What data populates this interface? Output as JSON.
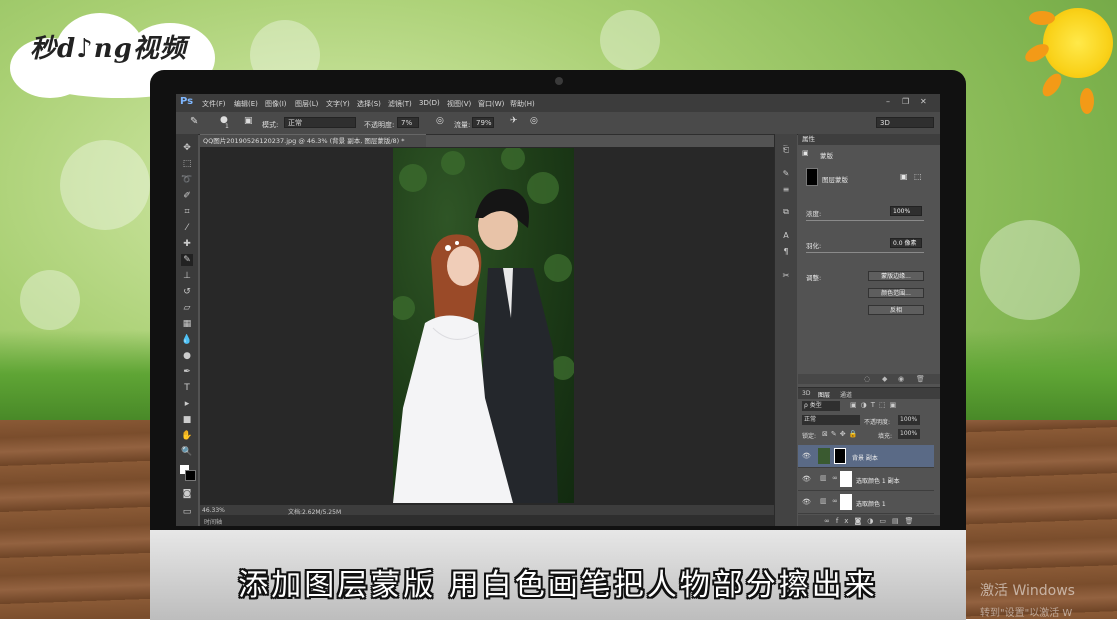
{
  "brand": {
    "logo_text": "秒d♪ng视频"
  },
  "app": {
    "ps_logo": "Ps",
    "menus": [
      "文件(F)",
      "编辑(E)",
      "图像(I)",
      "图层(L)",
      "文字(Y)",
      "选择(S)",
      "滤镜(T)",
      "3D(D)",
      "视图(V)",
      "窗口(W)",
      "帮助(H)"
    ],
    "window_controls": [
      "–",
      "❐",
      "✕"
    ]
  },
  "options": {
    "mode_label": "模式:",
    "mode_value": "正常",
    "opacity_label": "不透明度:",
    "opacity_value": "7%",
    "flow_label": "流量:",
    "flow_value": "79%",
    "workspace": "3D",
    "brush_size": "1"
  },
  "document": {
    "tab_title": "QQ图片20190526120237.jpg @ 46.3% (背景 副本, 图层蒙版/8) *",
    "tab_close": "×",
    "zoom": "46.33%",
    "doc_size": "文档:2.62M/5.25M",
    "timeline": "时间轴"
  },
  "properties": {
    "panel_title": "属性",
    "mask_type": "蒙版",
    "mask_name": "图层蒙版",
    "density_label": "浓度:",
    "density_value": "100%",
    "feather_label": "羽化:",
    "feather_value": "0.0 像素",
    "adjust_label": "调整:",
    "buttons": [
      "蒙版边缘...",
      "颜色范围...",
      "反相"
    ]
  },
  "layers": {
    "tabs": [
      "3D",
      "图层",
      "通道"
    ],
    "filter_kind": "ρ 类型",
    "blend_mode": "正常",
    "opacity_label": "不透明度:",
    "opacity_value": "100%",
    "lock_label": "锁定:",
    "fill_label": "填充:",
    "fill_value": "100%",
    "rows": [
      {
        "name": "背景 副本"
      },
      {
        "name": "选取颜色 1 副本"
      },
      {
        "name": "选取颜色 1"
      }
    ]
  },
  "subtitle": "添加图层蒙版  用白色画笔把人物部分擦出来",
  "watermark": {
    "line1": "激活 Windows",
    "line2": "转到\"设置\"以激活 W"
  },
  "colors": {
    "ps_bg": "#535353",
    "accent": "#7fb7ff",
    "layer_selected": "#5a6a86"
  }
}
